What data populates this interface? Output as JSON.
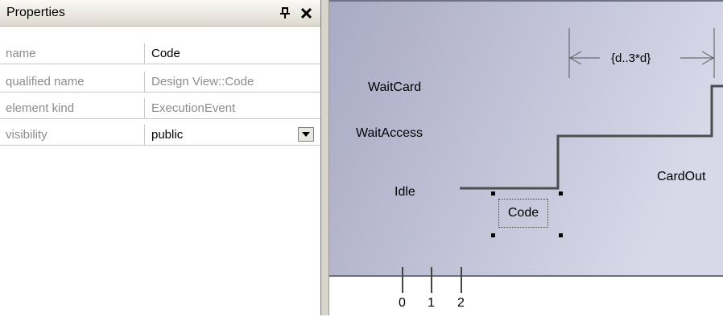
{
  "properties_panel": {
    "title": "Properties",
    "pin_icon": "pin-icon",
    "close_icon": "close-icon",
    "rows": [
      {
        "name": "name",
        "value": "Code"
      },
      {
        "name": "qualified name",
        "value": "Design View::Code"
      },
      {
        "name": "element kind",
        "value": "ExecutionEvent"
      },
      {
        "name": "visibility",
        "value": "public"
      }
    ]
  },
  "diagram": {
    "states": [
      "WaitCard",
      "WaitAccess",
      "Idle"
    ],
    "duration_constraint": "{d..3*d}",
    "event_label": "Code",
    "message_label": "CardOut",
    "ticks": [
      "0",
      "1",
      "2"
    ],
    "colors": {
      "frame_top": "#a9aac4",
      "frame_bottom": "#d7d8e8",
      "timeline": "#4d4d4d"
    }
  }
}
